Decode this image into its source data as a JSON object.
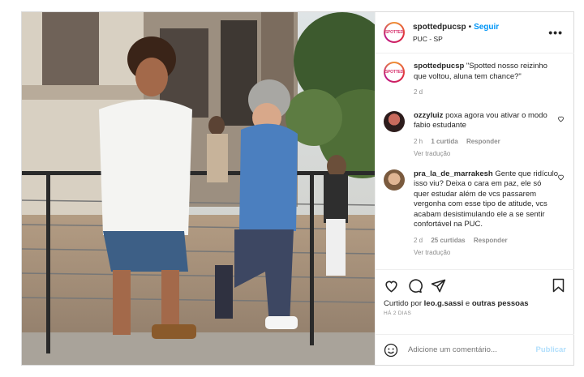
{
  "post": {
    "username": "spottedpucsp",
    "follow_label": "Seguir",
    "location": "PUC - SP",
    "avatar_text": "SPOTTED",
    "more_label": "•••"
  },
  "caption": {
    "username": "spottedpucsp",
    "text": "\"Spotted nosso reizinho que voltou, aluna tem chance?\"",
    "time": "2 d"
  },
  "comments": [
    {
      "username": "ozzyluiz",
      "text": "poxa agora vou ativar o modo fabio estudante",
      "time": "2 h",
      "likes": "1 curtida",
      "reply": "Responder",
      "translate": "Ver tradução"
    },
    {
      "username": "pra_la_de_marrakesh",
      "text": "Gente que ridículo isso viu? Deixa o cara em paz, ele só quer estudar além de vcs passarem vergonha com esse tipo de atitude, vcs acabam desistimulando ele a se sentir confortável na PUC.",
      "time": "2 d",
      "likes": "25 curtidas",
      "reply": "Responder",
      "translate": "Ver tradução"
    }
  ],
  "likes_line": {
    "prefix": "Curtido por",
    "user": "leo.g.sassi",
    "connector": "e",
    "others": "outras pessoas"
  },
  "posted_ago": "HÁ 2 DIAS",
  "add_comment": {
    "placeholder": "Adicione um comentário...",
    "publish_label": "Publicar"
  },
  "colors": {
    "accent": "#0095f6",
    "publish_disabled": "#b2dffc",
    "muted": "#8e8e8e",
    "text": "#262626"
  },
  "icons": [
    "heart-icon",
    "comment-icon",
    "share-icon",
    "bookmark-icon",
    "emoji-icon",
    "more-icon"
  ]
}
